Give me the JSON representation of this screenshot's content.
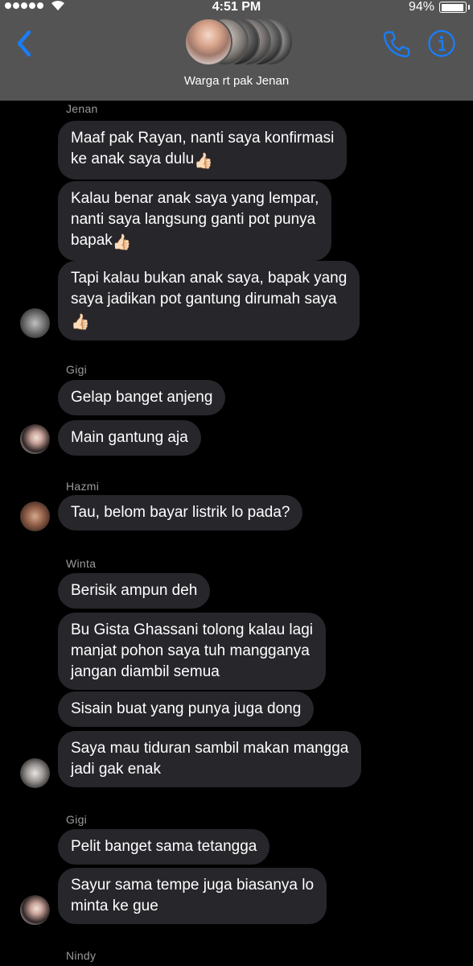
{
  "status_bar": {
    "time": "4:51 PM",
    "battery_percent": "94%",
    "battery_level": 0.94,
    "signal_dots": 5
  },
  "header": {
    "group_name": "Warga rt pak Jenan",
    "back_icon": "chevron-left-icon",
    "call_icon": "phone-icon",
    "info_icon": "info-icon",
    "accent_color": "#1a7cf5"
  },
  "messages": [
    {
      "sender": "Jenan",
      "bubbles": [
        "Maaf pak Rayan, nanti saya konfirmasi\nke anak saya dulu",
        "Kalau benar anak saya yang lempar,\nnanti saya langsung ganti pot punya\nbapak",
        "Tapi kalau bukan anak saya, bapak yang\nsaya jadikan pot gantung dirumah saya\n"
      ]
    },
    {
      "sender": "Gigi",
      "bubbles": [
        "Gelap banget anjeng",
        "Main gantung aja"
      ]
    },
    {
      "sender": "Hazmi",
      "bubbles": [
        "Tau, belom bayar listrik lo pada?"
      ]
    },
    {
      "sender": "Winta",
      "bubbles": [
        "Berisik ampun deh",
        "Bu Gista Ghassani tolong kalau lagi\nmanjat pohon saya tuh mangganya\njangan diambil semua",
        "Sisain buat yang punya juga dong",
        "Saya mau tiduran sambil makan mangga\njadi gak enak"
      ]
    },
    {
      "sender": "Gigi",
      "bubbles": [
        "Pelit banget sama tetangga",
        "Sayur sama tempe juga biasanya lo\nminta ke gue"
      ]
    },
    {
      "sender": "Nindy",
      "bubbles": []
    }
  ]
}
